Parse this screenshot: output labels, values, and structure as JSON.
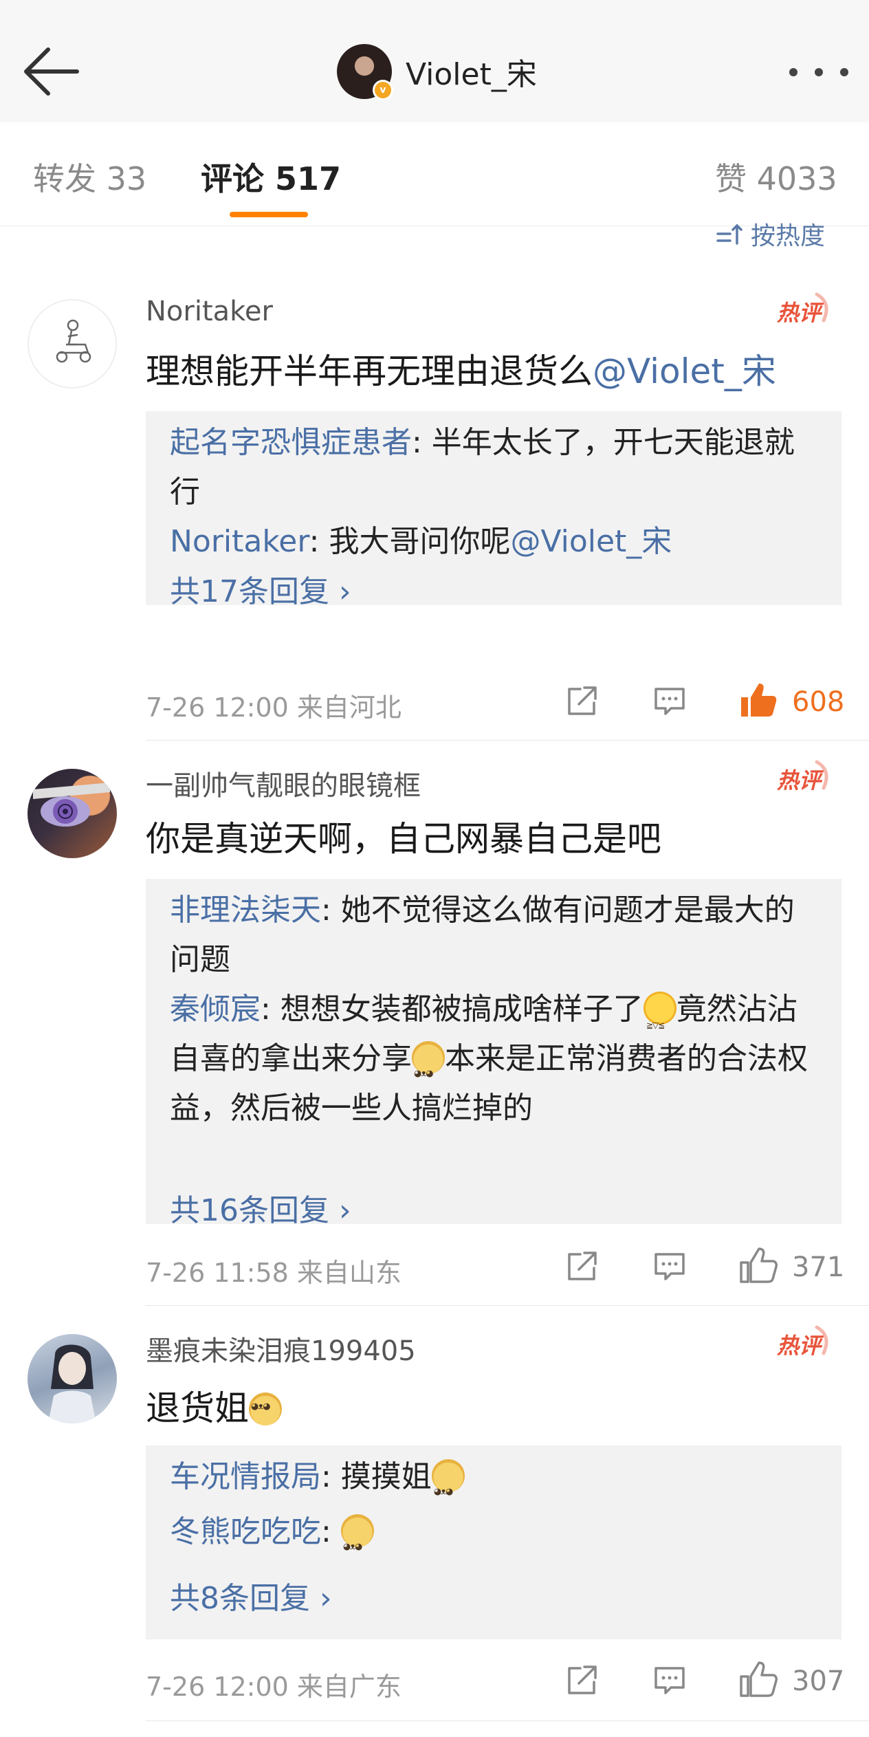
{
  "header": {
    "title": "Violet_宋"
  },
  "tabs": {
    "repost": "转发 33",
    "comments": "评论 517",
    "likes": "赞 4033"
  },
  "sort": {
    "label": "按热度"
  },
  "comments": [
    {
      "user": "Noritaker",
      "badge": "热评",
      "text": "理想能开半年再无理由退货么",
      "mention": "@Violet_宋",
      "replies": [
        {
          "name": "起名字恐惧症患者",
          "text": ": 半年太长了，开七天能退就行"
        },
        {
          "name": "Noritaker",
          "text": ": 我大哥问你呢",
          "mention": "@Violet_宋"
        }
      ],
      "more": "共17条回复 ›",
      "time": "7-26 12:00 来自河北",
      "likes": "608"
    },
    {
      "user": "一副帅气靓眼的眼镜框",
      "badge": "热评",
      "text": "你是真逆天啊，自己网暴自己是吧",
      "replies": [
        {
          "name": "非理法柒天",
          "text": ": 她不觉得这么做有问题才是最大的问题"
        },
        {
          "name": "秦倾宸",
          "text": ": 想想女装都被搞成啥样子了",
          "text2": "竟然沾沾自喜的拿出来分享",
          "text3": "本来是正常消费者的合法权益，然后被一些人搞烂掉的"
        }
      ],
      "more": "共16条回复 ›",
      "time": "7-26 11:58 来自山东",
      "likes": "371"
    },
    {
      "user": "墨痕未染泪痕199405",
      "badge": "热评",
      "text": "退货姐",
      "replies": [
        {
          "name": "车况情报局",
          "text": ": 摸摸姐"
        },
        {
          "name": "冬熊吃吃吃",
          "text": ": "
        }
      ],
      "more": "共8条回复 ›",
      "time": "7-26 12:00 来自广东",
      "likes": "307"
    }
  ],
  "icons": {
    "back": "back-arrow-icon",
    "more": "more-dots-icon",
    "share": "share-icon",
    "comment": "comment-icon",
    "like": "thumbs-up-icon",
    "verified": "verified-v-icon",
    "sort": "sort-icon"
  },
  "colors": {
    "accent": "#ff8200",
    "link": "#4a6fa5",
    "hot": "#e8533a",
    "like_active": "#ee6f1e"
  }
}
